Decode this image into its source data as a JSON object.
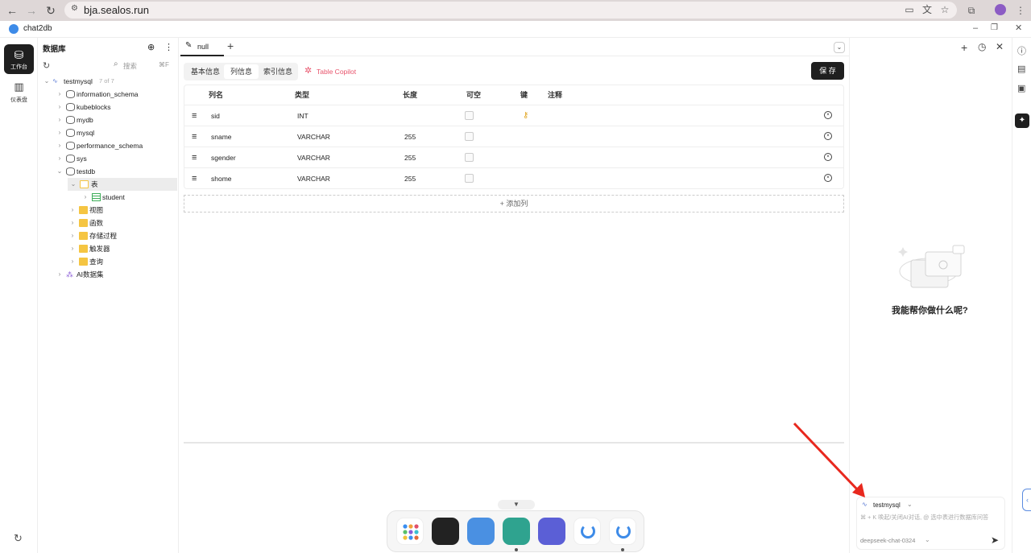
{
  "browser": {
    "url": "bja.sealos.run",
    "back_icon": "arrow-left-icon",
    "forward_icon": "arrow-right-icon",
    "reload_icon": "reload-icon"
  },
  "app": {
    "title": "chat2db"
  },
  "rail": {
    "workspace_label": "工作台",
    "dashboard_label": "仪表盘"
  },
  "tree": {
    "header": "数据库",
    "search_placeholder": "搜索",
    "search_shortcut": "⌘F",
    "connection": {
      "name": "testmysql",
      "count": "7 of 7"
    },
    "databases": [
      "information_schema",
      "kubeblocks",
      "mydb",
      "mysql",
      "performance_schema",
      "sys",
      "testdb"
    ],
    "testdb_children": {
      "tables_folder": "表",
      "table": "student",
      "folders": [
        "视图",
        "函数",
        "存储过程",
        "触发器",
        "查询"
      ]
    },
    "ai_dataset": "AI数据集"
  },
  "editor": {
    "tab_title": "null",
    "segments": [
      "基本信息",
      "列信息",
      "索引信息"
    ],
    "copilot": "Table Copilot",
    "save": "保 存",
    "columns_header": [
      "列名",
      "类型",
      "长度",
      "可空",
      "键",
      "注释"
    ],
    "rows": [
      {
        "name": "sid",
        "type": "INT",
        "length": "",
        "key": true
      },
      {
        "name": "sname",
        "type": "VARCHAR",
        "length": "255",
        "key": false
      },
      {
        "name": "sgender",
        "type": "VARCHAR",
        "length": "255",
        "key": false
      },
      {
        "name": "shome",
        "type": "VARCHAR",
        "length": "255",
        "key": false
      }
    ],
    "add_column": "添加列"
  },
  "assistant": {
    "prompt": "我能帮你做什么呢?",
    "connection": "testmysql",
    "input_placeholder": "⌘ + K 唤起/关闭AI对话, @ 选中表进行数据库问答",
    "model": "deepseek-chat-0324"
  },
  "colors": {
    "accent": "#1f1f1f",
    "copilot": "#e8546c",
    "key": "#e0a31c",
    "folder": "#f5c542",
    "table_icon": "#3fae5a"
  }
}
